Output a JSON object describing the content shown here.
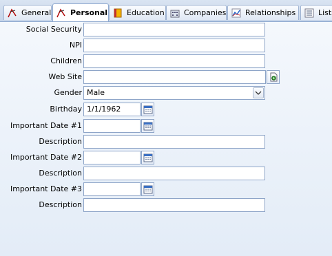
{
  "tabs": [
    {
      "label": "General",
      "icon": "general-tab-icon"
    },
    {
      "label": "Personal",
      "icon": "personal-tab-icon"
    },
    {
      "label": "Education",
      "icon": "education-book-icon"
    },
    {
      "label": "Companies",
      "icon": "companies-building-icon"
    },
    {
      "label": "Relationships",
      "icon": "relationships-chart-icon"
    },
    {
      "label": "Lists",
      "icon": "lists-icon"
    }
  ],
  "active_tab": "Personal",
  "form": {
    "social_security": {
      "label": "Social Security",
      "value": ""
    },
    "npi": {
      "label": "NPI",
      "value": ""
    },
    "children": {
      "label": "Children",
      "value": ""
    },
    "web_site": {
      "label": "Web Site",
      "value": "",
      "button_icon": "browse-web-icon"
    },
    "gender": {
      "label": "Gender",
      "value": "Male"
    },
    "birthday": {
      "label": "Birthday",
      "value": "1/1/1962"
    },
    "important_date_1": {
      "label": "Important Date #1",
      "value": ""
    },
    "description_1": {
      "label": "Description",
      "value": ""
    },
    "important_date_2": {
      "label": "Important Date #2",
      "value": ""
    },
    "description_2": {
      "label": "Description",
      "value": ""
    },
    "important_date_3": {
      "label": "Important Date #3",
      "value": ""
    },
    "description_3": {
      "label": "Description",
      "value": ""
    }
  },
  "colors": {
    "tabbar_bg": "#c6d5ea",
    "field_border": "#8ea5c8",
    "panel_bg": "#eef3fa"
  }
}
